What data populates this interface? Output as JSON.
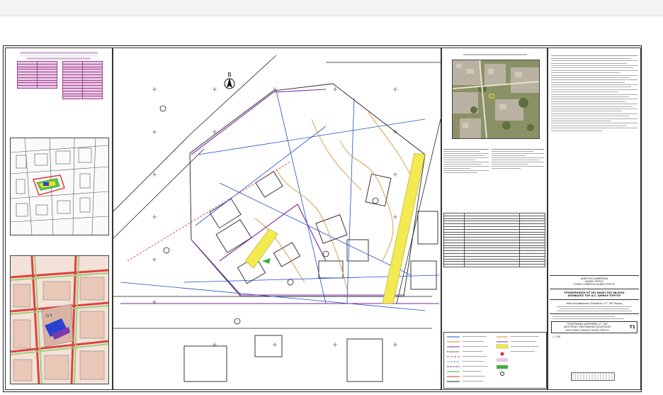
{
  "north_label": "B",
  "title_block": {
    "authority_lines": [
      "ΔΗΜΟΤΙΚΟ ΔΙΑΜΕΡΙΣΜΑ",
      "ΝΟΜΟΣ ΠΥΡΓΟΥ",
      "ΤΟΠΙΚΟ ΣΥΜΒΟΥΛΙΟ ΔΗΜΟΥ ΠΥΡΓΟΥ"
    ],
    "project_title": "ΤΡΟΠΟΠΟΙΗΣΗ ΟΤ 267 ΒΑΣΕΙ ΤΗΣ 86/2024",
    "project_subtitle": "ΑΠΟΦΑΣΗΣ ΤΟΥ Δ.Σ. ΔΗΜΟΥ ΠΥΡΓΟΥ",
    "description": "Λύση Κυκλοφοριακής Ρυθμίσεως Ο.Τ. 267 Πυργος",
    "box_lines": [
      "ΤΟΠΟΓΡΑΦΙΚΟ ΔΙΑΓΡΑΜΜΑ Ο.Τ. 267",
      "ΑΠΟΤΥΠΩΣΗ ΥΦΙΣΤΑΜΕΝΗΣ ΚΑΤΑΣΤΑΣΗΣ",
      "ΑΠΟΤΥΠΩΣΗ ΣΧΕΔΙΟΥ ΠΟΛΗΣ ΠΥΡΓΟΥ"
    ],
    "sheet_no": "T1",
    "scale": "1 : 250"
  },
  "colors": {
    "blue": "#2050c8",
    "orange": "#d08a20",
    "purple": "#7a2aa0",
    "yellow": "#f2ea50",
    "pink": "#e8c9e4"
  }
}
